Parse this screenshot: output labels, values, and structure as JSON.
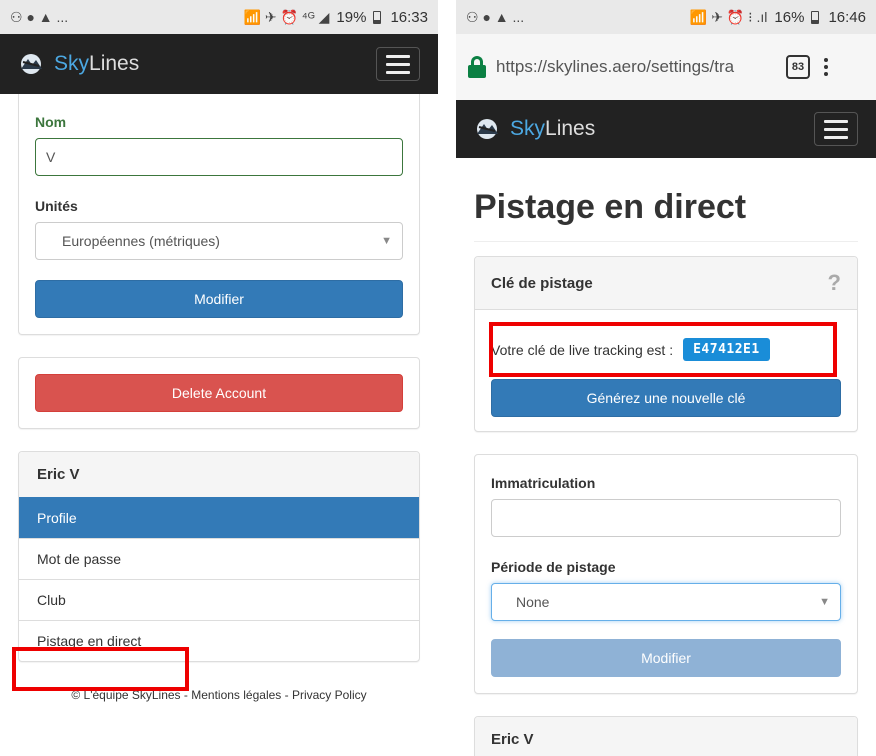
{
  "left": {
    "status": {
      "icons_left": "⚇ ● ▲ ...",
      "icons_right": "📶 ✈ ⏰ ⁴ᴳ ◢",
      "battery": "19%",
      "time": "16:33"
    },
    "brand": {
      "sky": "Sky",
      "lines": "Lines"
    },
    "form": {
      "name_label": "Nom",
      "name_value": "V",
      "units_label": "Unités",
      "units_value": "Européennes (métriques)",
      "submit_label": "Modifier"
    },
    "delete_label": "Delete Account",
    "menu": {
      "heading": "Eric V",
      "items": [
        "Profile",
        "Mot de passe",
        "Club",
        "Pistage en direct"
      ],
      "active_index": 0
    },
    "footer": "© L'équipe SkyLines - Mentions légales - Privacy Policy"
  },
  "right": {
    "status": {
      "icons_left": "⚇ ● ▲ ...",
      "icons_right": "📶 ✈ ⏰ ⁝ .ıl",
      "battery": "16%",
      "time": "16:46"
    },
    "browser": {
      "url": "https://skylines.aero/settings/tra",
      "tab_count": "83"
    },
    "brand": {
      "sky": "Sky",
      "lines": "Lines"
    },
    "page_title": "Pistage en direct",
    "key_panel": {
      "heading": "Clé de pistage",
      "help": "?",
      "text": "Votre clé de live tracking est :",
      "key": "E47412E1",
      "generate_label": "Générez une nouvelle clé"
    },
    "tracking_form": {
      "registration_label": "Immatriculation",
      "registration_value": "",
      "period_label": "Période de pistage",
      "period_value": "None",
      "submit_label": "Modifier"
    },
    "menu_heading": "Eric V"
  },
  "colors": {
    "primary": "#337ab7",
    "danger": "#d9534f",
    "navbar": "#222222",
    "brand_blue": "#4ca8e2",
    "highlight_red": "#ee0000",
    "key_badge": "#1a8dd8"
  }
}
